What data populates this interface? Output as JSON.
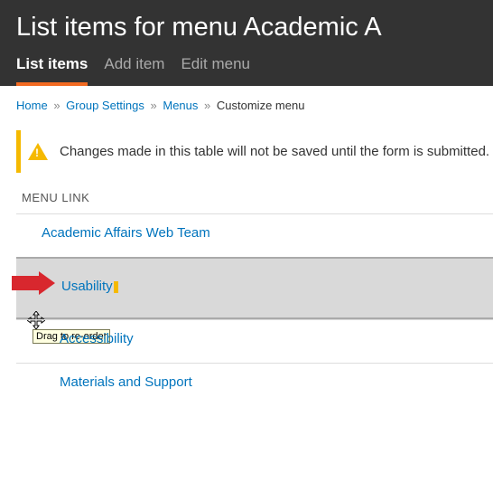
{
  "header": {
    "title": "List items for menu Academic A",
    "tabs": [
      {
        "label": "List items",
        "active": true
      },
      {
        "label": "Add item",
        "active": false
      },
      {
        "label": "Edit menu",
        "active": false
      }
    ]
  },
  "breadcrumbs": {
    "links": [
      "Home",
      "Group Settings",
      "Menus"
    ],
    "current": "Customize menu"
  },
  "message": "Changes made in this table will not be saved until the form is submitted.",
  "table": {
    "column_header": "MENU LINK",
    "rows": [
      {
        "label": "Academic Affairs Web Team",
        "indent": false,
        "dragged": false
      },
      {
        "label": "Usability",
        "indent": true,
        "dragged": true
      },
      {
        "label": "Accessibility",
        "indent": true,
        "dragged": false
      },
      {
        "label": "Materials and Support",
        "indent": true,
        "dragged": false
      }
    ]
  },
  "tooltip": "Drag to re-order"
}
